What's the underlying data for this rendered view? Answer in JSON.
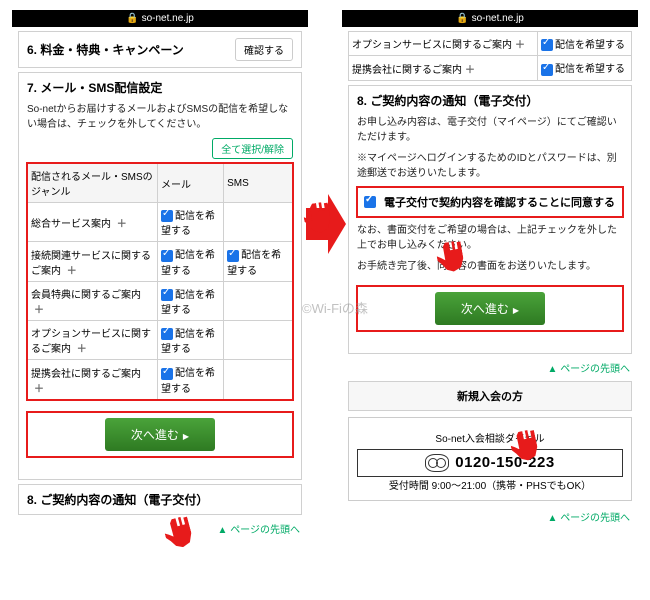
{
  "domain": "so-net.ne.jp",
  "left": {
    "section6": {
      "title": "6. 料金・特典・キャンペーン",
      "confirm": "確認する"
    },
    "section7": {
      "title": "7. メール・SMS配信設定",
      "desc": "So-netからお届けするメールおよびSMSの配信を希望しない場合は、チェックを外してください。",
      "toggle_all": "全て選択/解除",
      "head_genre": "配信されるメール・SMSのジャンル",
      "head_mail": "メール",
      "head_sms": "SMS",
      "want": "配信を希望する",
      "rows": [
        {
          "label": "総合サービス案内",
          "mail": true,
          "sms": false
        },
        {
          "label": "接続関連サービスに関するご案内",
          "mail": true,
          "sms": true
        },
        {
          "label": "会員特典に関するご案内",
          "mail": true,
          "sms": false
        },
        {
          "label": "オプションサービスに関するご案内",
          "mail": true,
          "sms": false
        },
        {
          "label": "提携会社に関するご案内",
          "mail": true,
          "sms": false
        }
      ],
      "next": "次へ進む"
    },
    "section8": {
      "title": "8. ご契約内容の通知（電子交付）"
    },
    "pagetop": "ページの先頭へ"
  },
  "right": {
    "carry": {
      "rowA": "オプションサービスに関するご案内",
      "rowB": "提携会社に関するご案内",
      "want": "配信を希望する"
    },
    "section8": {
      "title": "8. ご契約内容の通知（電子交付）",
      "p1": "お申し込み内容は、電子交付（マイページ）にてご確認いただけます。",
      "p2": "※マイページへログインするためのIDとパスワードは、別途郵送でお送りいたします。",
      "agree": "電子交付で契約内容を確認することに同意する",
      "p3": "なお、書面交付をご希望の場合は、上記チェックを外した上でお申し込みください。",
      "p4": "お手続き完了後、同内容の書面をお送りいたします。",
      "next": "次へ進む"
    },
    "newjoin": {
      "head": "新規入会の方",
      "sub": "So-net入会相談ダイヤル",
      "tel": "0120-150-223",
      "hours": "受付時間 9:00～21:00（携帯・PHSでもOK）"
    },
    "pagetop": "ページの先頭へ"
  },
  "watermark": "©Wi-Fiの森"
}
